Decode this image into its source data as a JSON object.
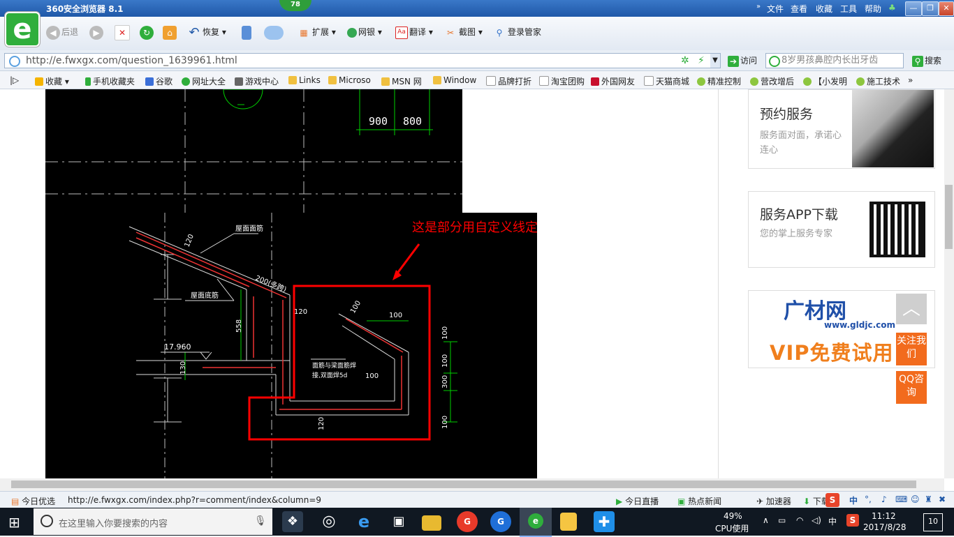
{
  "window": {
    "title": "360安全浏览器 8.1",
    "badge": "78",
    "menu": [
      "文件",
      "查看",
      "收藏",
      "工具",
      "帮助"
    ]
  },
  "toolbar": {
    "back": "后退",
    "restore": "恢复",
    "extend": "扩展",
    "bank": "网银",
    "translate": "翻译",
    "screenshot": "截图",
    "login_manager": "登录管家"
  },
  "address": {
    "url": "http://e.fwxgx.com/question_1639961.html",
    "visit": "访问",
    "search_placeholder": "8岁男孩鼻腔内长出牙齿",
    "search_button": "搜索"
  },
  "bookmarks": [
    "收藏",
    "手机收藏夹",
    "谷歌",
    "网址大全",
    "游戏中心",
    "Links",
    "Microso",
    "MSN 网",
    "Window",
    "品牌打折",
    "淘宝团购",
    "外国网友",
    "天猫商城",
    "精准控制",
    "营改增后",
    "【小发明",
    "施工技术"
  ],
  "drawing": {
    "dim_900": "900",
    "dim_800": "800",
    "annotation": "这是部分用自定义线定义",
    "label_roof_rebar": "屋面面筋",
    "label_200": "200(多跨)",
    "label_roof_bottom": "屋面底筋",
    "label_120a": "120",
    "label_120b": "120",
    "label_120c": "120",
    "label_558": "558",
    "label_elev": "17.960",
    "label_130": "130",
    "label_100a": "100",
    "label_100b": "100",
    "label_100c": "100",
    "label_100d": "100",
    "label_100e": "100",
    "label_100f": "100",
    "label_300": "300",
    "label_note1": "面筋与梁面筋焊",
    "label_note2": "接,双面焊5d"
  },
  "sidebar": {
    "card1_title": "预约服务",
    "card1_sub": "服务面对面，承诺心连心",
    "card2_title": "服务APP下载",
    "card2_sub": "您的掌上服务专家",
    "ad_brand": "广材网",
    "ad_url": "www.gldjc.com",
    "ad_vip": "VIP免费试用",
    "follow": "关注我们",
    "qq": "QQ咨询"
  },
  "statusbar": {
    "today_pick": "今日优选",
    "link": "http://e.fwxgx.com/index.php?r=comment/index&column=9",
    "live": "今日直播",
    "hot_news": "热点新闻",
    "accelerator": "加速器",
    "download": "下载"
  },
  "taskbar": {
    "search": "在这里输入你要搜索的内容",
    "cpu_percent": "49%",
    "cpu_label": "CPU使用",
    "ime": "中",
    "time": "11:12",
    "date": "2017/8/28",
    "notifications": "10"
  },
  "colors": {
    "accent_green": "#2fae3c",
    "annotation_red": "#ff0000",
    "cad_green": "#00d000",
    "cad_bg": "#000000",
    "orange": "#f26b1d"
  }
}
